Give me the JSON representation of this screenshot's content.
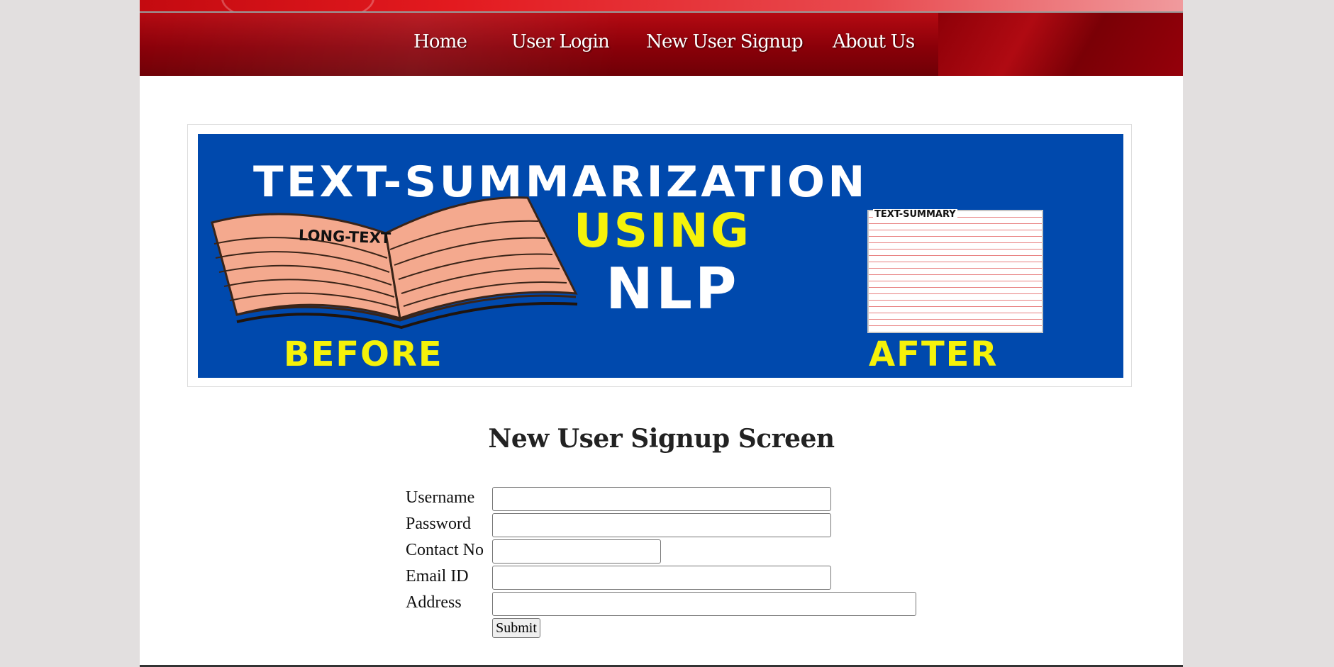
{
  "nav": {
    "items": [
      {
        "label": "Home"
      },
      {
        "label": "User Login"
      },
      {
        "label": "New User Signup"
      },
      {
        "label": "About Us"
      }
    ]
  },
  "banner": {
    "title": "TEXT-SUMMARIZATION",
    "using": "USING",
    "nlp": "NLP",
    "before": "BEFORE",
    "after": "AFTER",
    "book_label": "LONG-TEXT",
    "summary_label": "TEXT-SUMMARY"
  },
  "form": {
    "title": "New User Signup Screen",
    "fields": [
      {
        "label": "Username",
        "value": ""
      },
      {
        "label": "Password",
        "value": ""
      },
      {
        "label": "Contact No",
        "value": ""
      },
      {
        "label": "Email ID",
        "value": ""
      },
      {
        "label": "Address",
        "value": ""
      }
    ],
    "submit_label": "Submit"
  },
  "colors": {
    "nav_red": "#8a0009",
    "banner_blue": "#0049ad",
    "banner_yellow": "#f5f20a",
    "page_bg": "#e2dfdf"
  }
}
